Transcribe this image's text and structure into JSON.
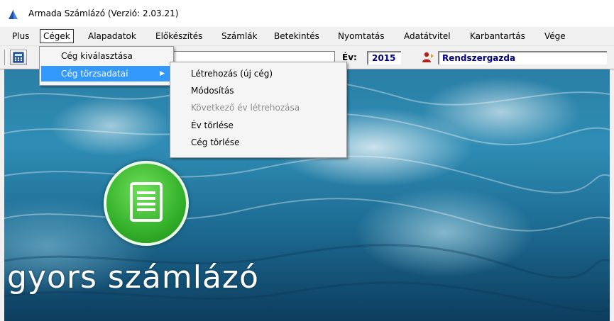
{
  "window": {
    "title": "Armada Számlázó (Verzió: 2.03.21)"
  },
  "menubar": {
    "items": [
      "Plus",
      "Cégek",
      "Alapadatok",
      "Előkészítés",
      "Számlák",
      "Betekintés",
      "Nyomtatás",
      "Adatátvitel",
      "Karbantartás",
      "Vége"
    ],
    "active": "Cégek"
  },
  "toolbar": {
    "year_label": "Év:",
    "year_value": "2015",
    "user_value": "Rendszergazda",
    "company_value": ""
  },
  "cegek_menu": {
    "items": [
      "Cég kiválasztása",
      "Cég törzsadatai"
    ],
    "selected": "Cég törzsadatai"
  },
  "torzsadatai_submenu": {
    "items": [
      {
        "label": "Létrehozás (új cég)",
        "enabled": true
      },
      {
        "label": "Módosítás",
        "enabled": true
      },
      {
        "label": "Következő év létrehozása",
        "enabled": false
      },
      {
        "label": "Év törlése",
        "enabled": true
      },
      {
        "label": "Cég törlése",
        "enabled": true
      }
    ]
  },
  "background": {
    "brand_text": "gyors számlázó"
  },
  "colors": {
    "menu_highlight": "#3399ff",
    "field_text": "#000080",
    "logo_green": "#34b02a"
  }
}
